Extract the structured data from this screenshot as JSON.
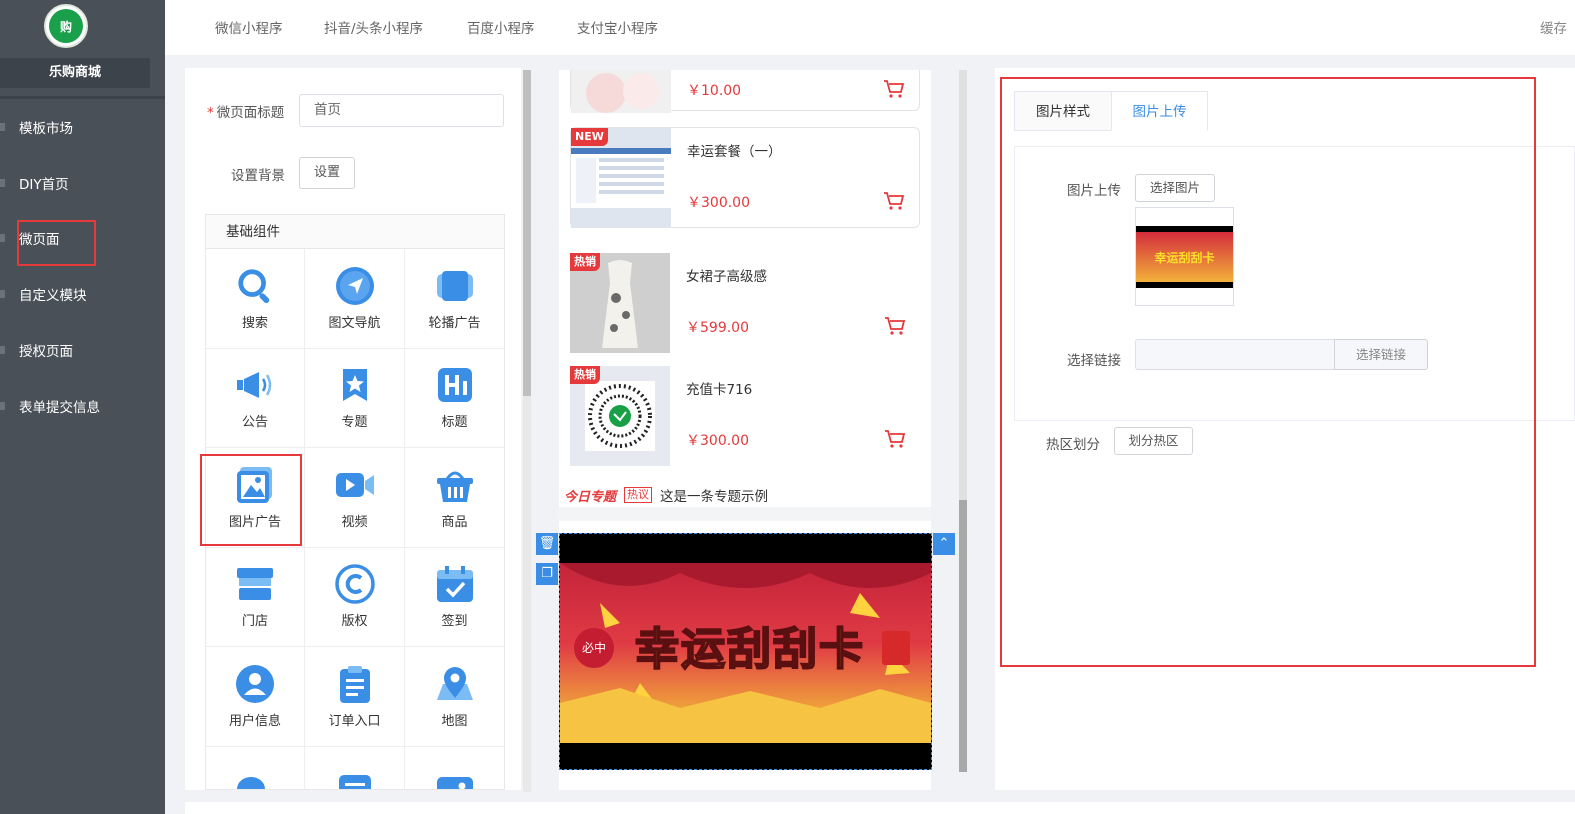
{
  "sidebar": {
    "logo_text": "购",
    "shop_name": "乐购商城",
    "items": [
      {
        "label": "模板市场"
      },
      {
        "label": "DIY首页"
      },
      {
        "label": "微页面"
      },
      {
        "label": "自定义模块"
      },
      {
        "label": "授权页面"
      },
      {
        "label": "表单提交信息"
      }
    ]
  },
  "topbar": {
    "tabs": [
      "微信小程序",
      "抖音/头条小程序",
      "百度小程序",
      "支付宝小程序"
    ],
    "cache": "缓存"
  },
  "left_panel": {
    "title_label": "微页面标题",
    "title_value": "首页",
    "bg_label": "设置背景",
    "bg_button": "设置",
    "components_header": "基础组件",
    "components": [
      "搜索",
      "图文导航",
      "轮播广告",
      "公告",
      "专题",
      "标题",
      "图片广告",
      "视频",
      "商品",
      "门店",
      "版权",
      "签到",
      "用户信息",
      "订单入口",
      "地图",
      "",
      "",
      ""
    ]
  },
  "preview": {
    "products": [
      {
        "name": "",
        "price": "￥10.00",
        "badge": ""
      },
      {
        "name": "幸运套餐（一）",
        "price": "￥300.00",
        "badge": "NEW"
      },
      {
        "name": "女裙子高级感",
        "price": "￥599.00",
        "badge": "热销"
      },
      {
        "name": "充值卡716",
        "price": "￥300.00",
        "badge": "热销"
      }
    ],
    "notice_logo": "今日专题",
    "notice_tag": "热议",
    "notice_text": "这是一条专题示例",
    "ad_text": "幸运刮刮卡",
    "ad_small": "必中"
  },
  "right_panel": {
    "tabs": [
      "图片样式",
      "图片上传"
    ],
    "upload_label": "图片上传",
    "upload_button": "选择图片",
    "thumb_text": "幸运刮刮卡",
    "link_label": "选择链接",
    "link_button": "选择链接",
    "hotzone_label": "热区划分",
    "hotzone_button": "划分热区"
  },
  "colors": {
    "accent": "#3a8ee6",
    "danger": "#e5393b",
    "sidebar": "#4a5057"
  }
}
